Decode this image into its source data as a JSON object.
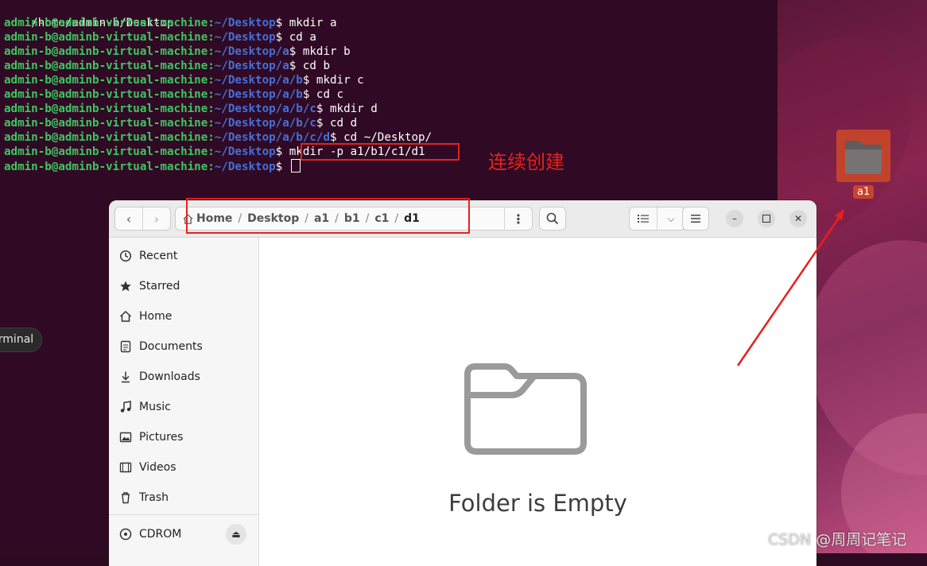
{
  "terminal": {
    "top_path": "/home/admin-b/Desktop",
    "lines": [
      {
        "user": "admin-b@adminb-virtual-machine",
        "colon": ":",
        "path": "~/Desktop",
        "cmd": "$ mkdir a"
      },
      {
        "user": "admin-b@adminb-virtual-machine",
        "colon": ":",
        "path": "~/Desktop",
        "cmd": "$ cd a"
      },
      {
        "user": "admin-b@adminb-virtual-machine",
        "colon": ":",
        "path": "~/Desktop/a",
        "cmd": "$ mkdir b"
      },
      {
        "user": "admin-b@adminb-virtual-machine",
        "colon": ":",
        "path": "~/Desktop/a",
        "cmd": "$ cd b"
      },
      {
        "user": "admin-b@adminb-virtual-machine",
        "colon": ":",
        "path": "~/Desktop/a/b",
        "cmd": "$ mkdir c"
      },
      {
        "user": "admin-b@adminb-virtual-machine",
        "colon": ":",
        "path": "~/Desktop/a/b",
        "cmd": "$ cd c"
      },
      {
        "user": "admin-b@adminb-virtual-machine",
        "colon": ":",
        "path": "~/Desktop/a/b/c",
        "cmd": "$ mkdir d"
      },
      {
        "user": "admin-b@adminb-virtual-machine",
        "colon": ":",
        "path": "~/Desktop/a/b/c",
        "cmd": "$ cd d"
      },
      {
        "user": "admin-b@adminb-virtual-machine",
        "colon": ":",
        "path": "~/Desktop/a/b/c/d",
        "cmd": "$ cd ~/Desktop/"
      },
      {
        "user": "admin-b@adminb-virtual-machine",
        "colon": ":",
        "path": "~/Desktop",
        "cmd": "$ mkdir -p a1/b1/c1/d1"
      },
      {
        "user": "admin-b@adminb-virtual-machine",
        "colon": ":",
        "path": "~/Desktop",
        "cmd": "$ "
      }
    ],
    "annotation": "连续创建",
    "tooltip": "Terminal"
  },
  "desktop": {
    "folder_label": "a1"
  },
  "file_manager": {
    "breadcrumbs": [
      "Home",
      "Desktop",
      "a1",
      "b1",
      "c1",
      "d1"
    ],
    "separator": "/",
    "sidebar": {
      "items": [
        {
          "label": "Recent",
          "icon": "clock-icon"
        },
        {
          "label": "Starred",
          "icon": "star-icon"
        },
        {
          "label": "Home",
          "icon": "home-icon"
        },
        {
          "label": "Documents",
          "icon": "document-icon"
        },
        {
          "label": "Downloads",
          "icon": "download-icon"
        },
        {
          "label": "Music",
          "icon": "music-icon"
        },
        {
          "label": "Pictures",
          "icon": "picture-icon"
        },
        {
          "label": "Videos",
          "icon": "video-icon"
        },
        {
          "label": "Trash",
          "icon": "trash-icon"
        }
      ],
      "device": {
        "label": "CDROM",
        "icon": "disc-icon"
      }
    },
    "empty_message": "Folder is Empty"
  },
  "watermark": "CSDN @周周记笔记",
  "colors": {
    "terminal_bg": "#300a24",
    "prompt_user": "#3fc561",
    "prompt_path": "#4670d8",
    "annotation_red": "#e8201e",
    "folder_orange": "#c7442a"
  }
}
